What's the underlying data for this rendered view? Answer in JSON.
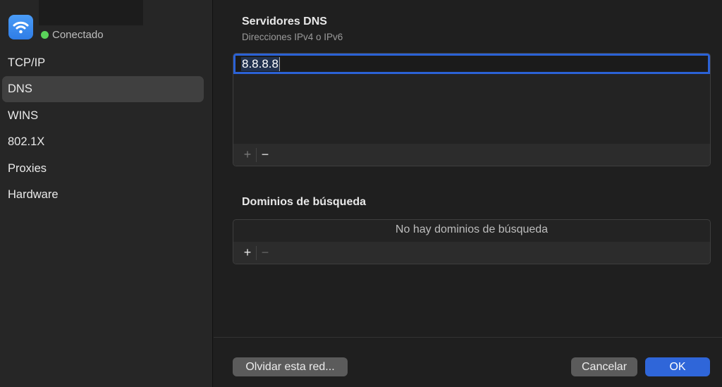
{
  "sidebar": {
    "status": "Conectado",
    "items": [
      {
        "label": "TCP/IP"
      },
      {
        "label": "DNS",
        "selected": true
      },
      {
        "label": "WINS"
      },
      {
        "label": "802.1X"
      },
      {
        "label": "Proxies"
      },
      {
        "label": "Hardware"
      }
    ]
  },
  "dns": {
    "title": "Servidores DNS",
    "subtitle": "Direcciones IPv4 o IPv6",
    "servers": [
      "8.8.8.8"
    ],
    "add": "+",
    "remove": "−"
  },
  "search": {
    "title": "Dominios de búsqueda",
    "empty": "No hay dominios de búsqueda",
    "add": "+",
    "remove": "−"
  },
  "footer": {
    "forget": "Olvidar esta red...",
    "cancel": "Cancelar",
    "ok": "OK"
  },
  "colors": {
    "accent": "#2f66d9",
    "connected": "#5ad35a"
  }
}
